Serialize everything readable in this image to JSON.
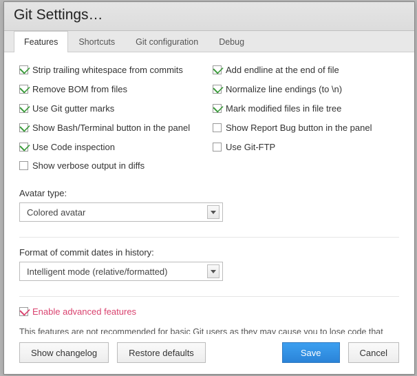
{
  "title": "Git Settings…",
  "tabs": {
    "features": "Features",
    "shortcuts": "Shortcuts",
    "gitconfig": "Git configuration",
    "debug": "Debug"
  },
  "left": [
    {
      "label": "Strip trailing whitespace from commits",
      "checked": true
    },
    {
      "label": "Remove BOM from files",
      "checked": true
    },
    {
      "label": "Use Git gutter marks",
      "checked": true
    },
    {
      "label": "Show Bash/Terminal button in the panel",
      "checked": true
    },
    {
      "label": "Use Code inspection",
      "checked": true
    },
    {
      "label": "Show verbose output in diffs",
      "checked": false
    }
  ],
  "right": [
    {
      "label": "Add endline at the end of file",
      "checked": true
    },
    {
      "label": "Normalize line endings (to \\n)",
      "checked": true
    },
    {
      "label": "Mark modified files in file tree",
      "checked": true
    },
    {
      "label": "Show Report Bug button in the panel",
      "checked": false
    },
    {
      "label": "Use Git-FTP",
      "checked": false
    }
  ],
  "avatar": {
    "label": "Avatar type:",
    "value": "Colored avatar"
  },
  "dateformat": {
    "label": "Format of commit dates in history:",
    "value": "Intelligent mode (relative/formatted)"
  },
  "advanced": {
    "label": "Enable advanced features",
    "checked": true,
    "note": "This features are not recommended for basic Git users as they may cause you to lose code that has been already commited if used inproperly. Use with caution."
  },
  "buttons": {
    "changelog": "Show changelog",
    "restore": "Restore defaults",
    "save": "Save",
    "cancel": "Cancel"
  }
}
